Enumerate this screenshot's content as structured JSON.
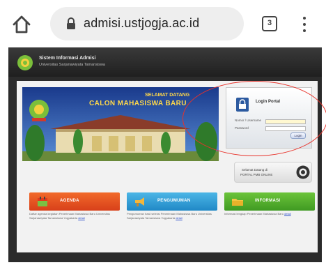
{
  "browser": {
    "url": "admisi.ustjogja.ac.id",
    "tab_count": "3"
  },
  "site": {
    "header_title": "Sistem Informasi Admisi",
    "header_subtitle": "Universitas Sarjanawiyata Tamansiswa"
  },
  "banner": {
    "small_text": "SELAMAT DATANG",
    "title": "CALON MAHASISWA BARU"
  },
  "login": {
    "title": "Login Portal",
    "username_label": "Nomor / Username",
    "username_value": "",
    "password_label": "Password",
    "password_value": "",
    "submit_label": "Login"
  },
  "help": {
    "line1": "Selamat Datang di",
    "line2": "PORTAL PMB ONLINE"
  },
  "cards": [
    {
      "label": "AGENDA",
      "body": "Daftar agenda kegiatan Penerimaan Mahasiswa Baru Universitas Sarjanawiyata Tamansiswa Yogyakarta",
      "link": "detail"
    },
    {
      "label": "PENGUMUMAN",
      "body": "Pengumuman hasil seleksi Penerimaan Mahasiswa Baru Universitas Sarjanawiyata Tamansiswa Yogyakarta",
      "link": "detail"
    },
    {
      "label": "INFORMASI",
      "body": "Informasi lengkap Penerimaan Mahasiswa Baru",
      "link": "detail"
    }
  ],
  "colors": {
    "card1": "#e8541c",
    "card2": "#2f9fd6",
    "card3": "#4caf2a",
    "annotation": "#e8322a"
  }
}
